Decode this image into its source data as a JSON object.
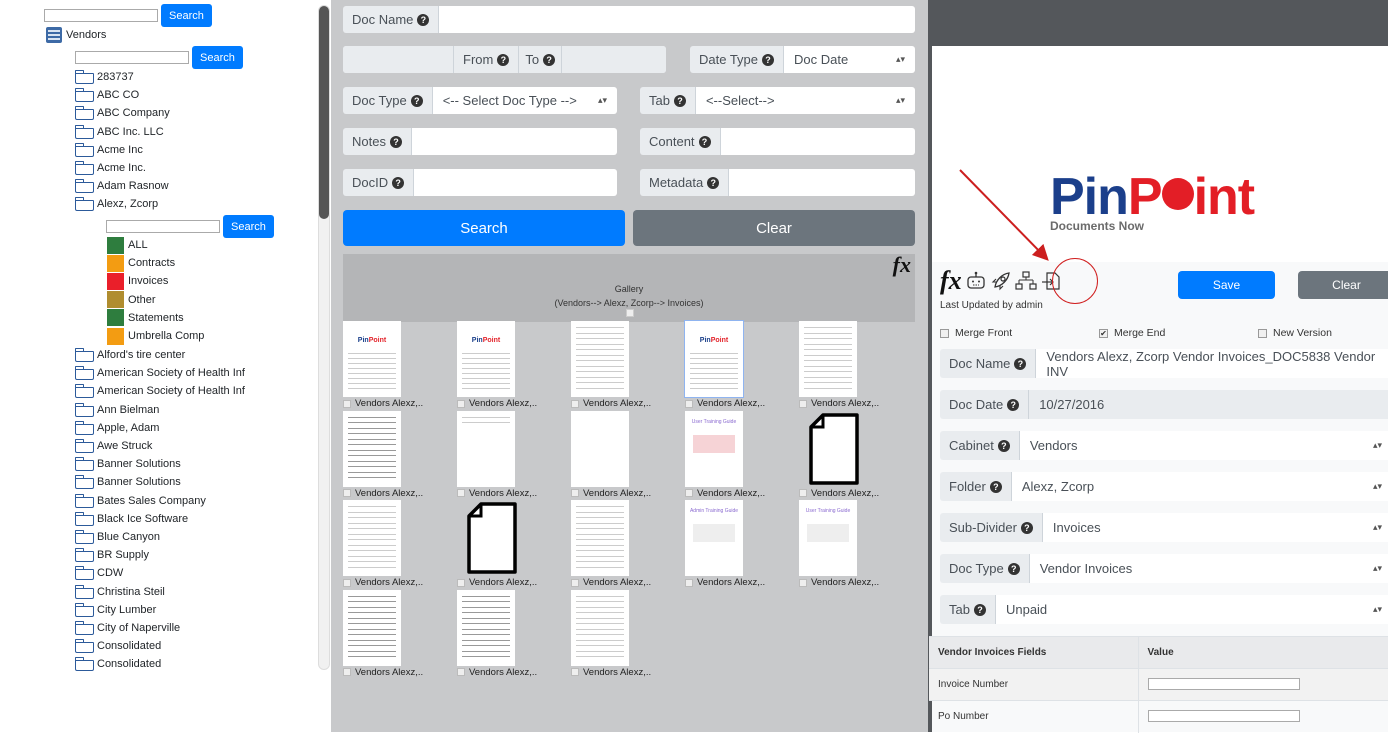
{
  "tree": {
    "search_button": "Search",
    "root": "Vendors",
    "folders_before": [
      "283737",
      "ABC CO",
      "ABC Company",
      "ABC Inc. LLC",
      "Acme Inc",
      "Acme Inc.",
      "Adam Rasnow",
      "Alexz, Zcorp"
    ],
    "tabs": [
      {
        "label": "ALL",
        "color": "#2e7d3e"
      },
      {
        "label": "Contracts",
        "color": "#f39c12"
      },
      {
        "label": "Invoices",
        "color": "#ea1f2a"
      },
      {
        "label": "Other",
        "color": "#b08d2f"
      },
      {
        "label": "Statements",
        "color": "#2e7d3e"
      },
      {
        "label": "Umbrella Comp",
        "color": "#f39c12"
      }
    ],
    "folders_after": [
      "Alford's tire center",
      "American Society of Health Inf",
      "American Society of Health Inf",
      "Ann Bielman",
      "Apple, Adam",
      "Awe Struck",
      "Banner Solutions",
      "Banner Solutions",
      "Bates Sales Company",
      "Black Ice Software",
      "Blue Canyon",
      "BR Supply",
      "CDW",
      "Christina Steil",
      "City Lumber",
      "City of Naperville",
      "Consolidated",
      "Consolidated"
    ]
  },
  "search": {
    "doc_name_label": "Doc Name",
    "from_label": "From",
    "to_label": "To",
    "date_type_label": "Date Type",
    "date_type_value": "Doc Date",
    "doc_type_label": "Doc Type",
    "doc_type_value": "<-- Select Doc Type -->",
    "tab_label": "Tab",
    "tab_value": "<--Select-->",
    "notes_label": "Notes",
    "content_label": "Content",
    "docid_label": "DocID",
    "metadata_label": "Metadata",
    "search_button": "Search",
    "clear_button": "Clear",
    "help_glyph": "?"
  },
  "gallery": {
    "title": "Gallery",
    "path": "(Vendors-->  Alexz, Zcorp--> Invoices)",
    "fx": "fx",
    "items": [
      {
        "caption": "Vendors Alexz,..",
        "kind": "pinpoint"
      },
      {
        "caption": "Vendors Alexz,..",
        "kind": "pinpoint"
      },
      {
        "caption": "Vendors Alexz,..",
        "kind": "text"
      },
      {
        "caption": "Vendors Alexz,..",
        "kind": "pinpoint",
        "selected": true
      },
      {
        "caption": "Vendors Alexz,..",
        "kind": "text"
      },
      {
        "caption": "Vendors Alexz,..",
        "kind": "form"
      },
      {
        "caption": "Vendors Alexz,..",
        "kind": "blank"
      },
      {
        "caption": "Vendors Alexz,..",
        "kind": "empty"
      },
      {
        "caption": "Vendors Alexz,..",
        "kind": "guide",
        "guide_title": "User Training Guide"
      },
      {
        "caption": "Vendors Alexz,..",
        "kind": "file-icon"
      },
      {
        "caption": "Vendors Alexz,..",
        "kind": "text"
      },
      {
        "caption": "Vendors Alexz,..",
        "kind": "file-icon"
      },
      {
        "caption": "Vendors Alexz,..",
        "kind": "text"
      },
      {
        "caption": "Vendors Alexz,..",
        "kind": "guide2",
        "guide_title": "Admin Training Guide"
      },
      {
        "caption": "Vendors Alexz,..",
        "kind": "guide2",
        "guide_title": "User Training Guide"
      },
      {
        "caption": "Vendors Alexz,..",
        "kind": "invoice"
      },
      {
        "caption": "Vendors Alexz,..",
        "kind": "invoice"
      },
      {
        "caption": "Vendors Alexz,..",
        "kind": "text"
      }
    ]
  },
  "detail": {
    "logo_pin": "Pin",
    "logo_p": "P",
    "logo_int": "int",
    "logo_sub": "Documents Now",
    "fx": "fx",
    "last_updated": "Last Updated by admin",
    "save_button": "Save",
    "clear_button": "Clear",
    "merge_front": "Merge Front",
    "merge_front_checked": false,
    "merge_end": "Merge End",
    "merge_end_checked": true,
    "new_version": "New Version",
    "new_version_checked": false,
    "fields": [
      {
        "label": "Doc Name",
        "value": "Vendors Alexz, Zcorp Vendor Invoices_DOC5838 Vendor INV",
        "type": "text"
      },
      {
        "label": "Doc Date",
        "value": "10/27/2016",
        "type": "readonly"
      },
      {
        "label": "Cabinet",
        "value": "Vendors",
        "type": "select"
      },
      {
        "label": "Folder",
        "value": "Alexz, Zcorp",
        "type": "select"
      },
      {
        "label": "Sub-Divider",
        "value": "Invoices",
        "type": "select"
      },
      {
        "label": "Doc Type",
        "value": "Vendor Invoices",
        "type": "select"
      },
      {
        "label": "Tab",
        "value": "Unpaid",
        "type": "select"
      }
    ],
    "table": {
      "headers": [
        "Vendor Invoices Fields",
        "Value"
      ],
      "rows": [
        {
          "field": "Invoice Number",
          "value": ""
        },
        {
          "field": "Po Number",
          "value": ""
        }
      ]
    },
    "annotation_color": "#cc1f1f"
  }
}
